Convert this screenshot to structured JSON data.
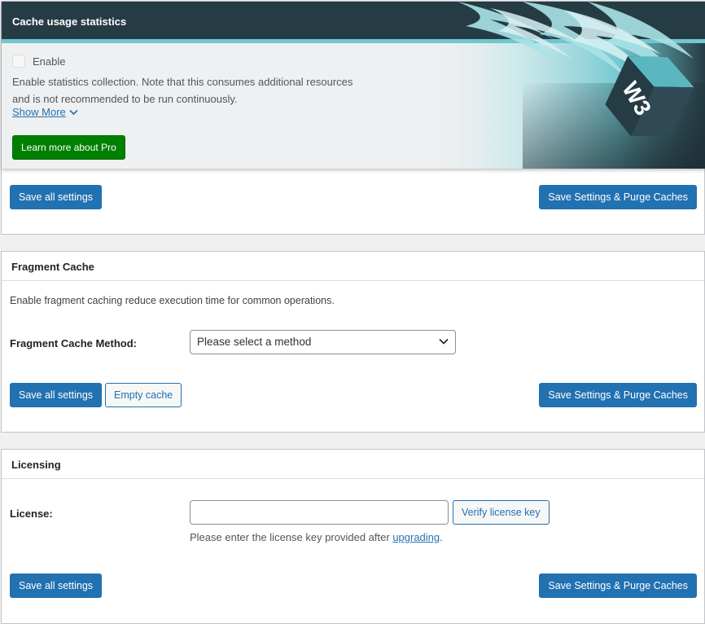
{
  "stats": {
    "title": "Cache usage statistics",
    "enable_label": "Enable",
    "enable_checked": false,
    "description_line1": "Enable statistics collection. Note that this consumes additional resources",
    "description_line2": "and is not recommended to be run continuously.",
    "show_more_label": "Show More",
    "learn_more_label": "Learn more about Pro",
    "save_label": "Save all settings",
    "save_purge_label": "Save Settings & Purge Caches",
    "logo_text": "W3"
  },
  "fragment": {
    "title": "Fragment Cache",
    "description": "Enable fragment caching reduce execution time for common operations.",
    "method_label": "Fragment Cache Method:",
    "method_selected": "Please select a method",
    "save_label": "Save all settings",
    "empty_label": "Empty cache",
    "save_purge_label": "Save Settings & Purge Caches"
  },
  "licensing": {
    "title": "Licensing",
    "license_label": "License:",
    "license_value": "",
    "verify_label": "Verify license key",
    "help_prefix": "Please enter the license key provided after ",
    "help_link": "upgrading",
    "help_suffix": ".",
    "save_label": "Save all settings",
    "save_purge_label": "Save Settings & Purge Caches"
  },
  "colors": {
    "primary": "#2271b1",
    "green": "#008000",
    "header_dark": "#263c45",
    "accent_teal": "#6fc7cf"
  }
}
